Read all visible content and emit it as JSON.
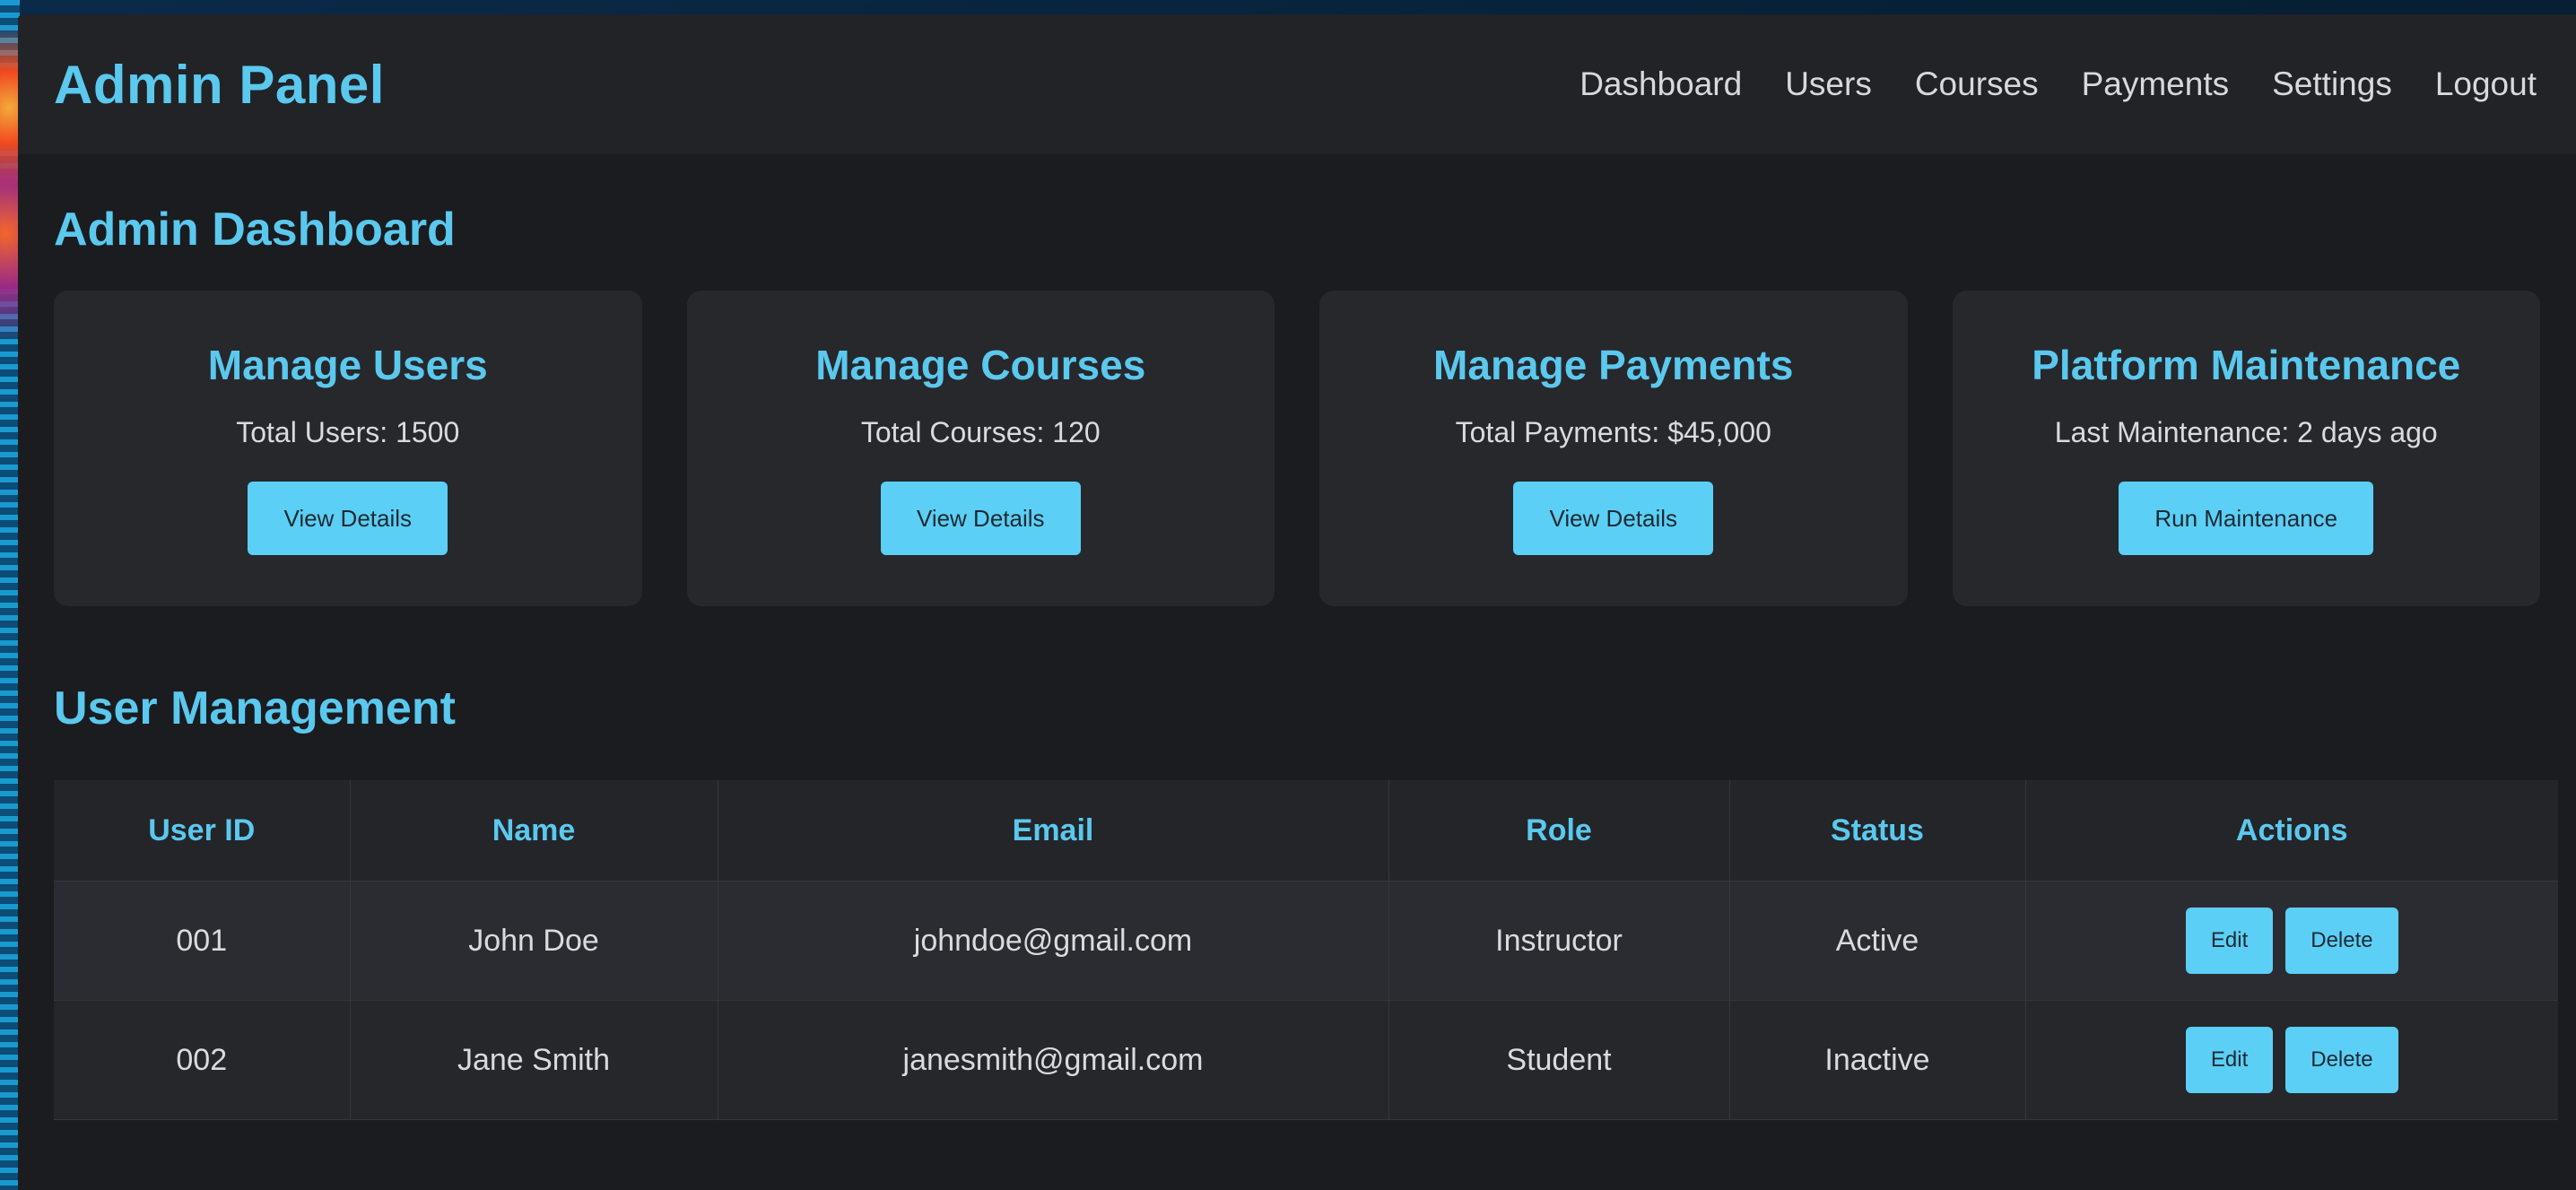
{
  "header": {
    "brand": "Admin Panel",
    "nav": [
      "Dashboard",
      "Users",
      "Courses",
      "Payments",
      "Settings",
      "Logout"
    ]
  },
  "dashboard": {
    "title": "Admin Dashboard",
    "cards": [
      {
        "title": "Manage Users",
        "stat": "Total Users: 1500",
        "button": "View Details"
      },
      {
        "title": "Manage Courses",
        "stat": "Total Courses: 120",
        "button": "View Details"
      },
      {
        "title": "Manage Payments",
        "stat": "Total Payments: $45,000",
        "button": "View Details"
      },
      {
        "title": "Platform Maintenance",
        "stat": "Last Maintenance: 2 days ago",
        "button": "Run Maintenance"
      }
    ]
  },
  "users": {
    "title": "User Management",
    "columns": [
      "User ID",
      "Name",
      "Email",
      "Role",
      "Status",
      "Actions"
    ],
    "rows": [
      {
        "id": "001",
        "name": "John Doe",
        "email": "johndoe@gmail.com",
        "role": "Instructor",
        "status": "Active",
        "edit": "Edit",
        "delete": "Delete"
      },
      {
        "id": "002",
        "name": "Jane Smith",
        "email": "janesmith@gmail.com",
        "role": "Student",
        "status": "Inactive",
        "edit": "Edit",
        "delete": "Delete"
      }
    ]
  },
  "colors": {
    "accent": "#5bc8ee",
    "button": "#5bcff5",
    "background": "#1a1c1f",
    "navbar": "#212327",
    "card": "#26282c"
  }
}
